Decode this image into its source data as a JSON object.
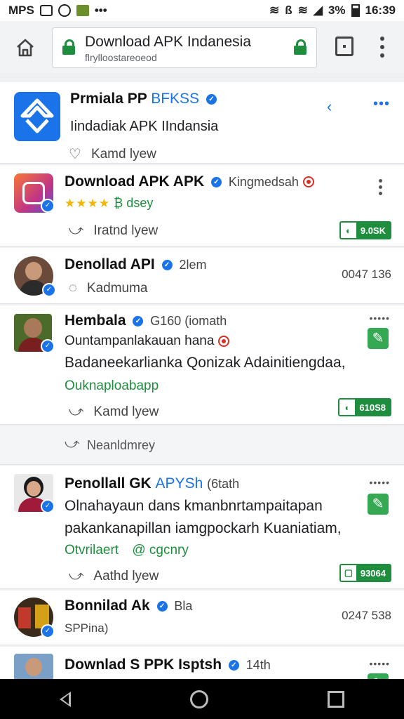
{
  "status": {
    "left_label": "MPS",
    "battery": "3%",
    "time": "16:39"
  },
  "browser": {
    "url_title": "Download APK  Indanesia",
    "url_sub": "flrylloostareoeod"
  },
  "cards": [
    {
      "title": "Prmiala PP",
      "tag": "BFKSS",
      "line1": "Iindadiak APK IIndansia",
      "action": "Kamd  lyew"
    },
    {
      "title": "Download APK APK",
      "meta": "Kingmedsah",
      "stars": "★★★★",
      "rating_text": "₿ dsey",
      "action": "Iratnd  lyew",
      "chip": "9.0SK"
    },
    {
      "title": "Denollad API",
      "meta": "2lem",
      "action": "Kadmuma",
      "num": "0047 136"
    },
    {
      "title": "Hembala",
      "meta": "G160 (iomath",
      "line1": "Ountampanlakauan hana",
      "line2": "Badaneekarlianka Qonizak Adainitiengdaa,",
      "line3": "Ouknaploabapp",
      "action": "Kamd  lyew",
      "chip": "610S8"
    },
    {
      "title": "Penollall GK",
      "tag": "APYSh",
      "meta": "(6tath",
      "line1": "Olnahayaun dans  kmanbnrtampaitapan",
      "line2": "pakankanapillan iamgpockarh Kuaniatiam,",
      "green1": "Otvrilaert",
      "green2": "@ cgcnry",
      "action": "Aathd  lyew",
      "chip": "93064"
    },
    {
      "title": "Bonnilad Ak",
      "meta": "Bla",
      "action": "SPPina)",
      "num": "0247 538"
    },
    {
      "title": "Downlad S PPK Isptsh",
      "meta": "14th"
    }
  ],
  "share_label": "Neanldmrey",
  "colors": {
    "accent": "#1a73e8",
    "green": "#1e8e3e",
    "lock": "#1e8e3e"
  }
}
